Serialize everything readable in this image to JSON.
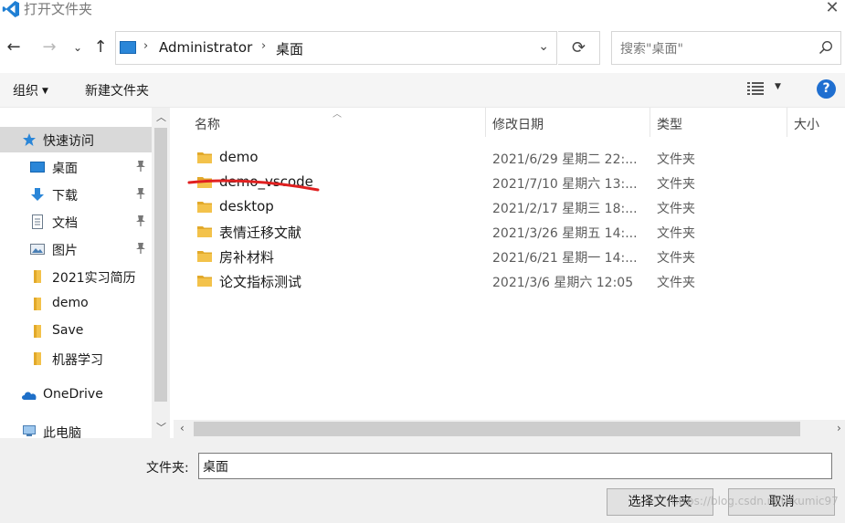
{
  "window": {
    "title": "打开文件夹"
  },
  "address": {
    "segments": [
      "Administrator",
      "桌面"
    ]
  },
  "search": {
    "placeholder": "搜索\"桌面\""
  },
  "toolbar": {
    "organize_label": "组织",
    "new_folder_label": "新建文件夹",
    "help_label": "?"
  },
  "sidebar": {
    "items": [
      {
        "label": "快速访问",
        "icon": "star-icon"
      },
      {
        "label": "桌面",
        "icon": "desktop-icon",
        "pinned": true
      },
      {
        "label": "下载",
        "icon": "download-icon",
        "pinned": true
      },
      {
        "label": "文档",
        "icon": "document-icon",
        "pinned": true
      },
      {
        "label": "图片",
        "icon": "picture-icon",
        "pinned": true
      },
      {
        "label": "2021实习简历",
        "icon": "folder-icon"
      },
      {
        "label": "demo",
        "icon": "folder-icon"
      },
      {
        "label": "Save",
        "icon": "folder-icon"
      },
      {
        "label": "机器学习",
        "icon": "folder-icon"
      },
      {
        "label": "OneDrive",
        "icon": "cloud-icon"
      },
      {
        "label": "此电脑",
        "icon": "computer-icon"
      }
    ]
  },
  "filelist": {
    "columns": [
      "名称",
      "修改日期",
      "类型",
      "大小"
    ],
    "rows": [
      {
        "name": "demo",
        "date": "2021/6/29 星期二 22:...",
        "type": "文件夹"
      },
      {
        "name": "demo_vscode",
        "date": "2021/7/10 星期六 13:...",
        "type": "文件夹"
      },
      {
        "name": "desktop",
        "date": "2021/2/17 星期三 18:...",
        "type": "文件夹"
      },
      {
        "name": "表情迁移文献",
        "date": "2021/3/26 星期五 14:...",
        "type": "文件夹"
      },
      {
        "name": "房补材料",
        "date": "2021/6/21 星期一 14:...",
        "type": "文件夹"
      },
      {
        "name": "论文指标测试",
        "date": "2021/3/6 星期六 12:05",
        "type": "文件夹"
      }
    ]
  },
  "bottom": {
    "folder_label": "文件夹:",
    "folder_value": "桌面",
    "select_button": "选择文件夹",
    "cancel_button": "取消",
    "watermark": "https://blog.csdn.net/ikumic97"
  },
  "colors": {
    "accent": "#1f6fd0",
    "folder": "#f3c24b",
    "annotation": "#e02020"
  }
}
